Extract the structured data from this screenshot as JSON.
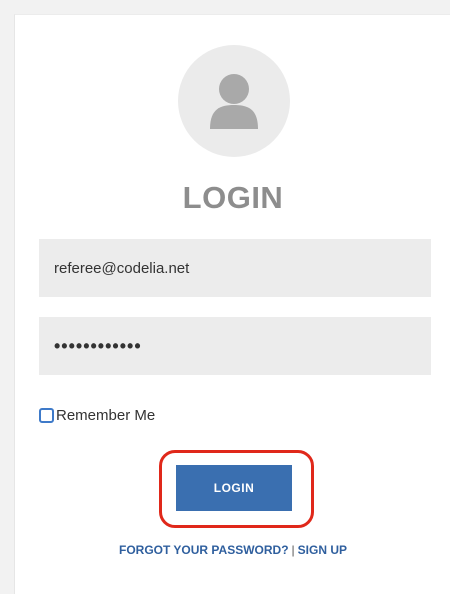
{
  "login": {
    "title": "LOGIN",
    "email_value": "referee@codelia.net",
    "password_value": "••••••••••••",
    "remember_label": "Remember Me",
    "submit_label": "LOGIN",
    "forgot_label": "FORGOT YOUR PASSWORD?",
    "separator": "|",
    "signup_label": "SIGN UP"
  },
  "icons": {
    "avatar": "user-avatar-icon"
  },
  "colors": {
    "button": "#3a6fb0",
    "link": "#2f5f9e",
    "highlight": "#e0281a",
    "title": "#8d8d8d"
  }
}
